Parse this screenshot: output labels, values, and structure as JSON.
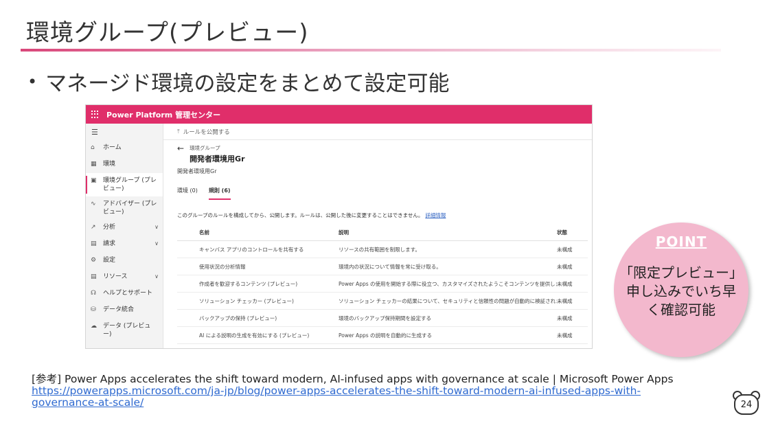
{
  "slide": {
    "title": "環境グループ(プレビュー)",
    "bullet": "マネージド環境の設定をまとめて設定可能"
  },
  "app": {
    "header_title": "Power Platform 管理センター",
    "nav": [
      {
        "label": "ホーム",
        "icon": "home-icon",
        "glyph": "⌂"
      },
      {
        "label": "環境",
        "icon": "environment-icon",
        "glyph": "▦"
      },
      {
        "label": "環境グループ (プレビュー)",
        "icon": "environment-group-icon",
        "glyph": "▣"
      },
      {
        "label": "アドバイザー (プレビュー)",
        "icon": "advisor-icon",
        "glyph": "∿"
      },
      {
        "label": "分析",
        "icon": "analytics-icon",
        "glyph": "↗"
      },
      {
        "label": "請求",
        "icon": "billing-icon",
        "glyph": "▤"
      },
      {
        "label": "設定",
        "icon": "settings-icon",
        "glyph": "⚙"
      },
      {
        "label": "リソース",
        "icon": "resources-icon",
        "glyph": "▤"
      },
      {
        "label": "ヘルプとサポート",
        "icon": "help-icon",
        "glyph": "☊"
      },
      {
        "label": "データ統合",
        "icon": "data-integration-icon",
        "glyph": "⛁"
      },
      {
        "label": "データ (プレビュー)",
        "icon": "data-icon",
        "glyph": "☁"
      }
    ],
    "command": "ルールを公開する",
    "breadcrumb_parent": "環境グループ",
    "page_title": "開発者環境用Gr",
    "description": "開発者環境用Gr",
    "tabs": [
      "環境 (0)",
      "規則 (6)"
    ],
    "info_text": "このグループのルールを構成してから、公開します。ルールは、公開した後に変更することはできません。",
    "info_link": "詳細情報",
    "table": {
      "headers": [
        "名前",
        "説明",
        "状態"
      ],
      "rows": [
        [
          "キャンバス アプリのコントロールを共有する",
          "リソースの共有範囲を制限します。",
          "未構成"
        ],
        [
          "使用状況の分析情報",
          "環境内の状況について情報を常に受け取る。",
          "未構成"
        ],
        [
          "作成者を歓迎するコンテンツ (プレビュー)",
          "Power Apps の使用を開始する際に役立つ、カスタマイズされたようこそコンテンツを提供します。",
          "未構成"
        ],
        [
          "ソリューション チェッカー (プレビュー)",
          "ソリューション チェッカーの結果について、セキュリティと信頼性の問題が自動的に検証されます。",
          "未構成"
        ],
        [
          "バックアップの保持 (プレビュー)",
          "環境のバックアップ保持期間を設定する",
          "未構成"
        ],
        [
          "AI による説明の生成を有効にする (プレビュー)",
          "Power Apps の説明を自動的に生成する",
          "未構成"
        ]
      ]
    }
  },
  "point": {
    "label": "POINT",
    "lines": [
      "「限定プレビュー」",
      "申し込みでいち早",
      "く確認可能"
    ]
  },
  "reference": {
    "text": "[参考] Power Apps accelerates the shift toward modern, AI-infused apps with governance at scale | Microsoft Power Apps",
    "url_line1": "https://powerapps.microsoft.com/ja-jp/blog/power-apps-accelerates-the-shift-toward-modern-ai-infused-apps-with-",
    "url_line2": "governance-at-scale/"
  },
  "page_number": "24",
  "colors": {
    "accent": "#e02e6a",
    "point_bg": "#f3b8cd",
    "link": "#2f6ad0"
  }
}
